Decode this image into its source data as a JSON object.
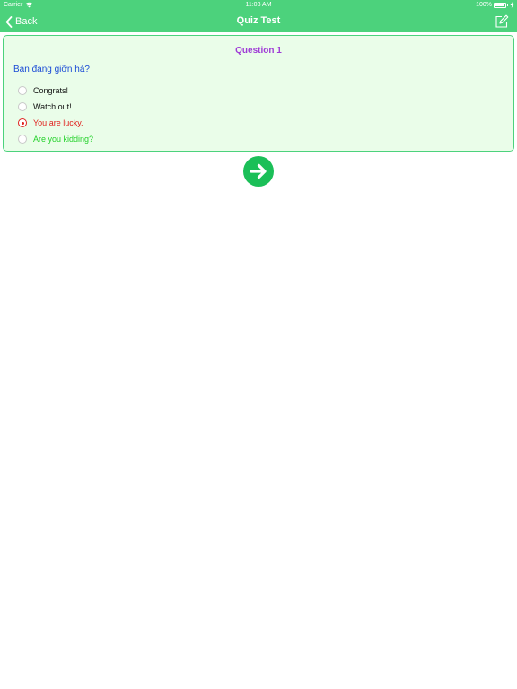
{
  "status_bar": {
    "carrier": "Carrier",
    "time": "11:03 AM",
    "battery": "100%",
    "battery_level": 1.0
  },
  "nav": {
    "back_label": "Back",
    "title": "Quiz Test",
    "back_icon": "chevron-left-icon",
    "edit_icon": "edit-icon"
  },
  "question": {
    "number_label": "Question 1",
    "text": "Bạn đang giỡn hả?",
    "options": [
      {
        "label": "Congrats!",
        "state": "normal"
      },
      {
        "label": "Watch out!",
        "state": "normal"
      },
      {
        "label": "You are lucky.",
        "state": "selected-wrong"
      },
      {
        "label": "Are you kidding?",
        "state": "correct"
      }
    ]
  },
  "next_button": {
    "icon": "arrow-right-icon"
  },
  "colors": {
    "header": "#4cd27c",
    "card_bg": "#eafde9",
    "question_number": "#9f3bd6",
    "question_text": "#1a4bd6",
    "wrong": "#e0211e",
    "correct": "#23d12a",
    "next_button": "#1bbf58"
  }
}
